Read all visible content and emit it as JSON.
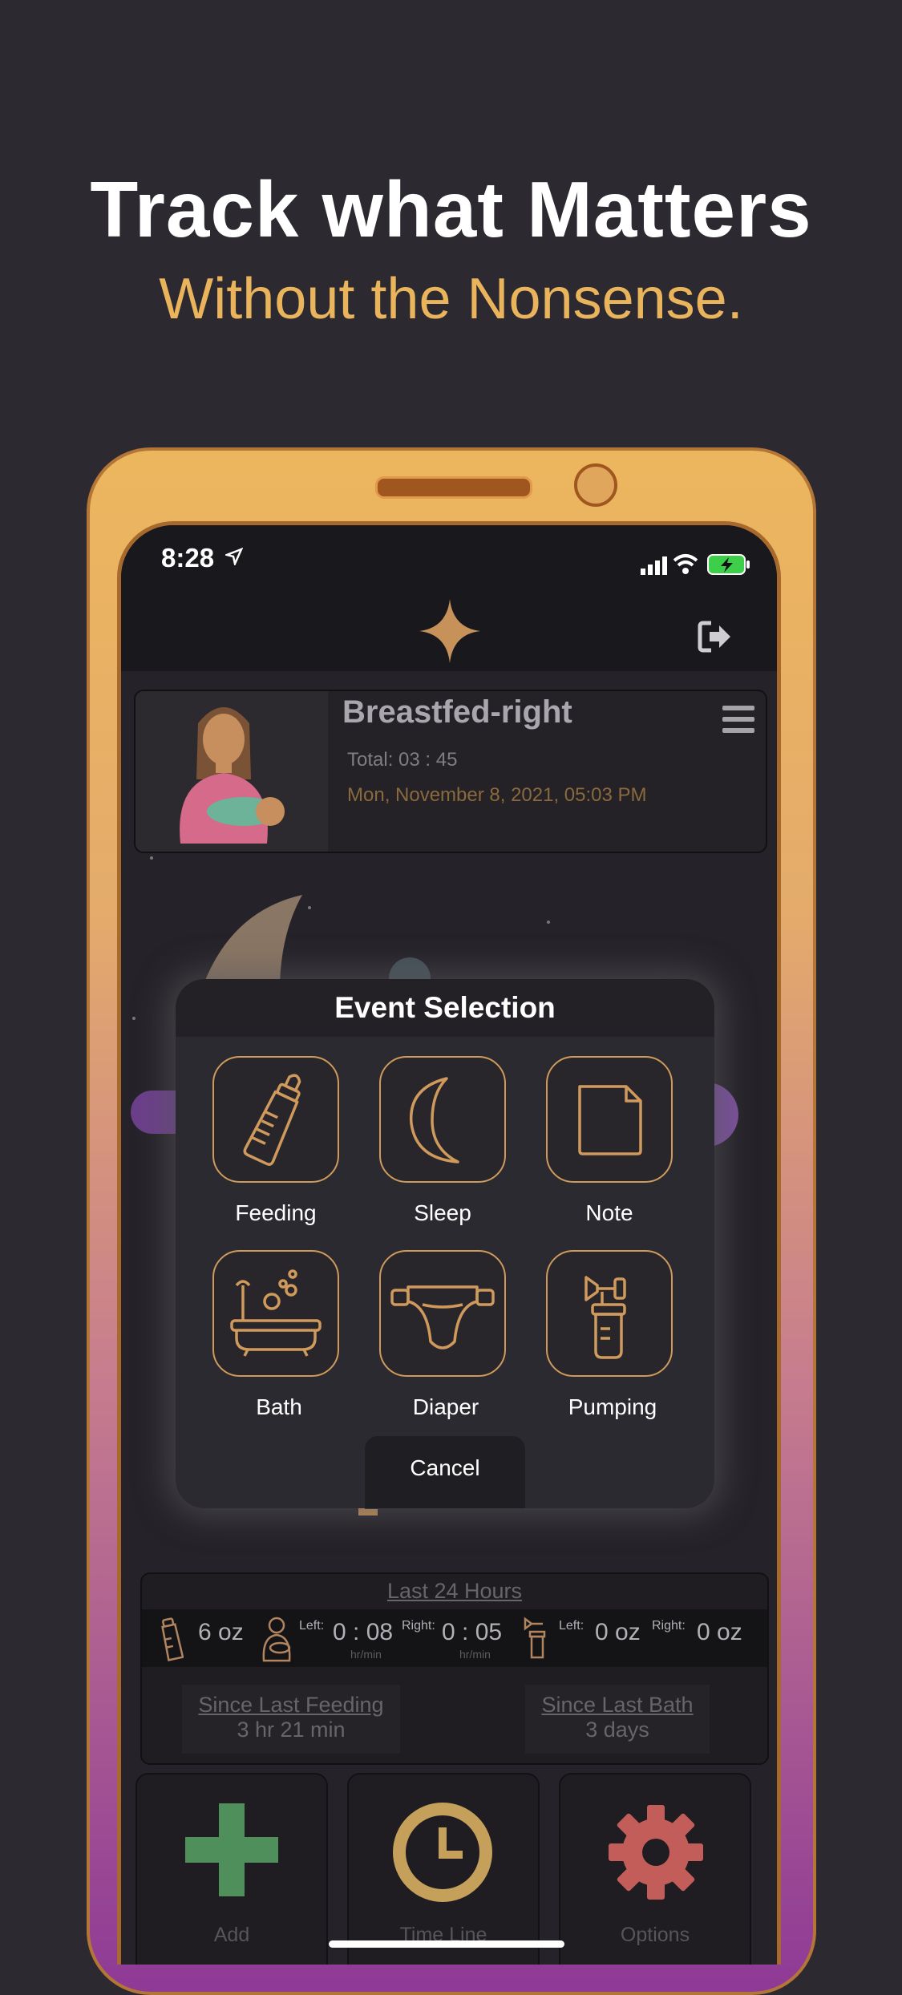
{
  "headline": "Track what Matters",
  "subheadline": "Without the Nonsense.",
  "status_bar": {
    "time": "8:28"
  },
  "event_card": {
    "title": "Breastfed-right",
    "total": "Total: 03 : 45",
    "datetime": "Mon, November 8, 2021, 05:03 PM"
  },
  "modal": {
    "title": "Event Selection",
    "options": [
      {
        "label": "Feeding",
        "icon": "baby-bottle-icon"
      },
      {
        "label": "Sleep",
        "icon": "crescent-moon-icon"
      },
      {
        "label": "Note",
        "icon": "note-icon"
      },
      {
        "label": "Bath",
        "icon": "bathtub-icon"
      },
      {
        "label": "Diaper",
        "icon": "diaper-icon"
      },
      {
        "label": "Pumping",
        "icon": "breast-pump-icon"
      }
    ],
    "cancel": "Cancel"
  },
  "stats": {
    "title": "Last 24 Hours",
    "bottle_amount": "6 oz",
    "breast_left_label": "Left:",
    "breast_left_time": "0 : 08",
    "breast_right_label": "Right:",
    "breast_right_time": "0 : 05",
    "time_unit": "hr/min",
    "pump_left_label": "Left:",
    "pump_left_amount": "0 oz",
    "pump_right_label": "Right:",
    "pump_right_amount": "0 oz",
    "since_feeding_label": "Since Last Feeding",
    "since_feeding_value": "3 hr 21 min",
    "since_bath_label": "Since Last Bath",
    "since_bath_value": "3 days"
  },
  "bottom_buttons": [
    {
      "label": "Add",
      "icon": "plus-icon",
      "color": "#4e8f5c"
    },
    {
      "label": "Time Line",
      "icon": "clock-icon",
      "color": "#c4a05a"
    },
    {
      "label": "Options",
      "icon": "gear-icon",
      "color": "#c25d59"
    }
  ],
  "colors": {
    "accent": "#e9b45b",
    "tile_border": "#cf9a5c",
    "background": "#2c2a30"
  }
}
